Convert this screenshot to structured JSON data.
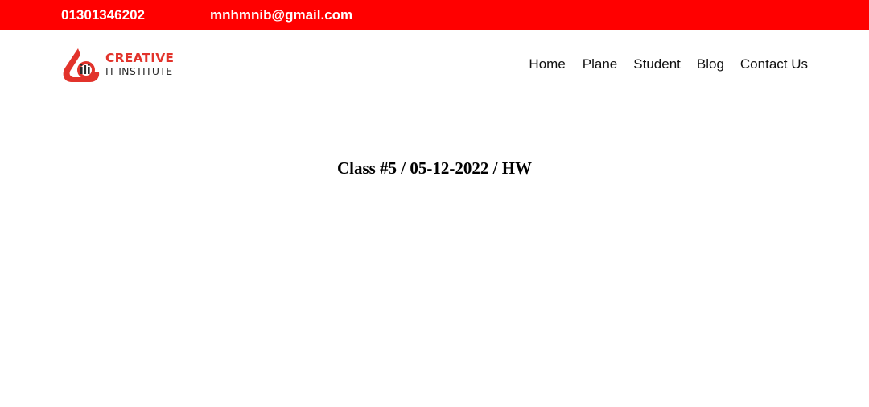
{
  "topbar": {
    "phone": "01301346202",
    "email": "mnhmnib@gmail.com",
    "background": "#ff0000"
  },
  "logo": {
    "line1": "CREATIVE",
    "line2": "IT INSTITUTE",
    "icon": "creative-it-logo-icon",
    "brand_color": "#e2332b"
  },
  "nav": {
    "items": [
      {
        "label": "Home"
      },
      {
        "label": "Plane"
      },
      {
        "label": "Student"
      },
      {
        "label": "Blog"
      },
      {
        "label": "Contact Us"
      }
    ]
  },
  "main": {
    "heading": "Class #5 / 05-12-2022 / HW"
  }
}
